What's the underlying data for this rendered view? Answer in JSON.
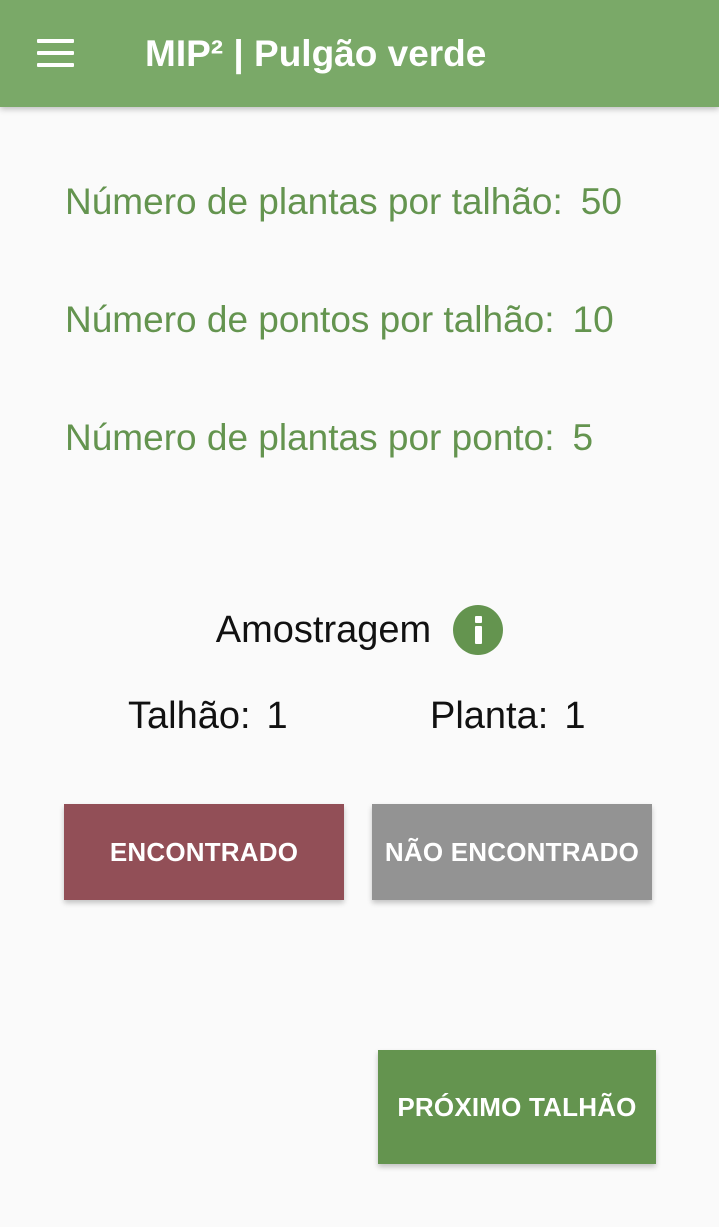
{
  "app_bar": {
    "menu_icon": "hamburger-menu-icon",
    "title": "MIP² | Pulgão verde",
    "color": "#7aa968"
  },
  "info": [
    {
      "label": "Número de plantas por talhão:",
      "value": "50"
    },
    {
      "label": "Número de pontos por talhão:",
      "value": "10"
    },
    {
      "label": "Número de plantas por ponto:",
      "value": "5"
    }
  ],
  "sampling": {
    "title": "Amostragem",
    "info_icon": "info-icon",
    "talhao_label": "Talhão:",
    "talhao_value": "1",
    "planta_label": "Planta:",
    "planta_value": "1"
  },
  "buttons": {
    "found": "ENCONTRADO",
    "not_found": "NÃO ENCONTRADO",
    "next": "PRÓXIMO TALHÃO"
  },
  "colors": {
    "primary": "#64944f",
    "found": "#924f57",
    "not_found": "#939393",
    "background": "#fafafa"
  }
}
